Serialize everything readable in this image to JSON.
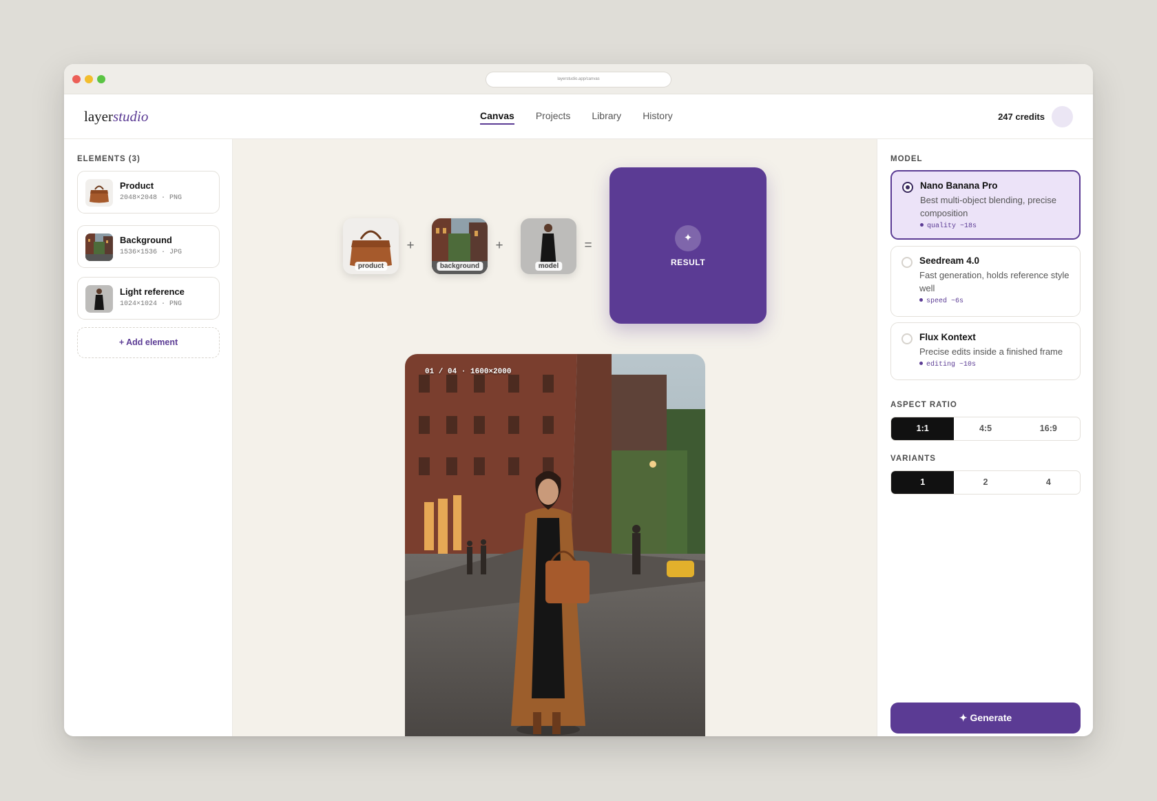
{
  "browser": {
    "url": "layerstudio.app/canvas"
  },
  "header": {
    "logo_main": "layer",
    "logo_italic": "studio",
    "nav": [
      "Canvas",
      "Projects",
      "Library",
      "History"
    ],
    "active_nav": "Canvas",
    "credits": "247 credits"
  },
  "elements": {
    "title": "ELEMENTS (3)",
    "items": [
      {
        "name": "Product",
        "meta": "2048×2048 · PNG"
      },
      {
        "name": "Background",
        "meta": "1536×1536 · JPG"
      },
      {
        "name": "Light reference",
        "meta": "1024×1024 · PNG"
      }
    ],
    "add_label": "+ Add element"
  },
  "canvas": {
    "chips": [
      "product",
      "background",
      "model"
    ],
    "ops": [
      "+",
      "+",
      "="
    ],
    "result_icon": "✦",
    "result_label": "RESULT",
    "preview_counter": "01 / 04 · 1600×2000"
  },
  "model_panel": {
    "title": "MODEL",
    "options": [
      {
        "name": "Nano Banana Pro",
        "desc": "Best multi-object blending, precise composition",
        "tag": "quality  ~18s",
        "selected": true
      },
      {
        "name": "Seedream 4.0",
        "desc": "Fast generation, holds reference style well",
        "tag": "speed  ~6s",
        "selected": false
      },
      {
        "name": "Flux Kontext",
        "desc": "Precise edits inside a finished frame",
        "tag": "editing  ~10s",
        "selected": false
      }
    ]
  },
  "aspect_ratio": {
    "title": "ASPECT RATIO",
    "options": [
      "1:1",
      "4:5",
      "16:9"
    ],
    "selected": "1:1"
  },
  "variants": {
    "title": "VARIANTS",
    "options": [
      "1",
      "2",
      "4"
    ],
    "selected": "1"
  },
  "generate_label": "✦ Generate",
  "colors": {
    "accent": "#5b3b94",
    "selected_bg": "#ece3f8",
    "canvas_bg": "#f4f1ea"
  }
}
